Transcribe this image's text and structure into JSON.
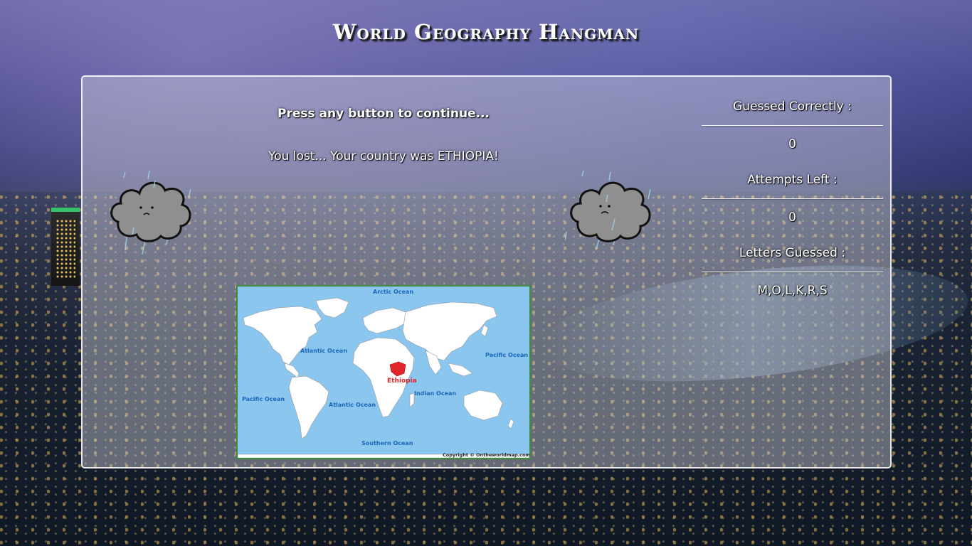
{
  "page": {
    "title": "World Geography Hangman"
  },
  "game": {
    "continue_prompt": "Press any button to continue...",
    "result_message": "You lost... Your country was ETHIOPIA!"
  },
  "stats": {
    "guessed_correctly_label": "Guessed Correctly :",
    "guessed_correctly_value": "0",
    "attempts_left_label": "Attempts Left :",
    "attempts_left_value": "0",
    "letters_guessed_label": "Letters Guessed :",
    "letters_guessed_value": "M,O,L,K,R,S"
  },
  "map": {
    "highlight_country": "Ethiopia",
    "oceans": {
      "arctic": "Arctic Ocean",
      "atlantic_north": "Atlantic Ocean",
      "atlantic_south": "Atlantic Ocean",
      "pacific_east": "Pacific Ocean",
      "pacific_west": "Pacific Ocean",
      "indian": "Indian Ocean",
      "southern": "Southern Ocean"
    },
    "copyright": "Copyright © Ontheworldmap.com",
    "colors": {
      "ocean": "#8bc6ef",
      "land": "#ffffff",
      "highlight": "#e0262c"
    }
  },
  "icons": {
    "sad_cloud": "sad-rain-cloud-icon"
  }
}
